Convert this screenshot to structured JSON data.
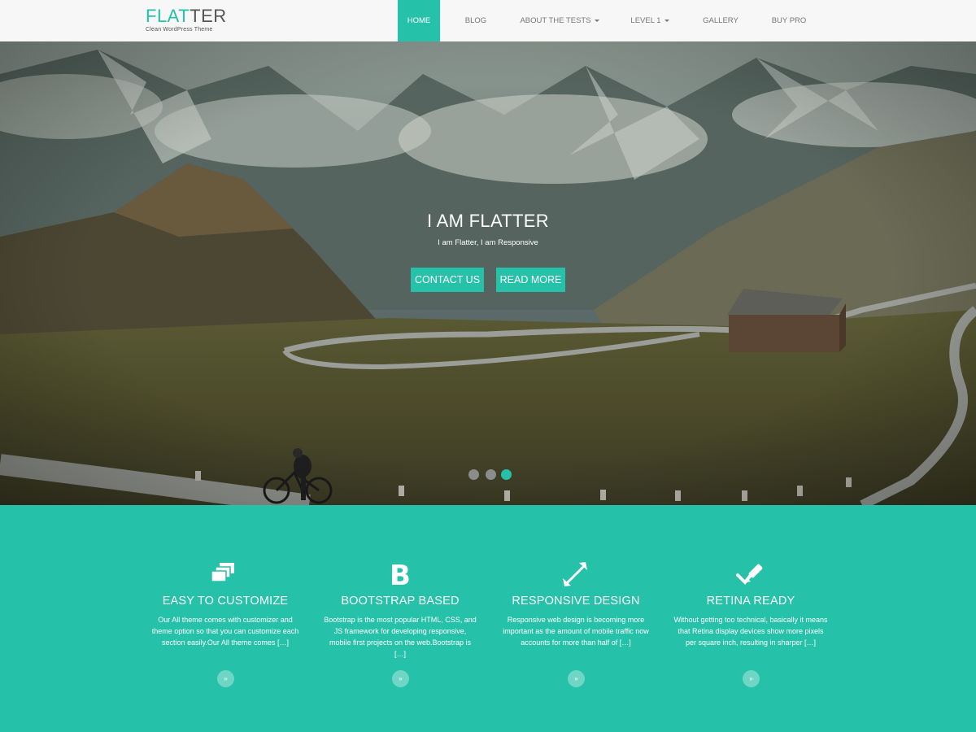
{
  "brand": {
    "name_part1": "FLAT",
    "name_part2": "TER",
    "tagline": "Clean WordPress Theme"
  },
  "nav": {
    "items": [
      {
        "label": "HOME",
        "active": true
      },
      {
        "label": "BLOG"
      },
      {
        "label": "ABOUT THE TESTS",
        "dropdown": true
      },
      {
        "label": "LEVEL 1",
        "dropdown": true
      },
      {
        "label": "GALLERY"
      },
      {
        "label": "BUY PRO"
      }
    ]
  },
  "hero": {
    "title": "I AM FLATTER",
    "subtitle": "I am Flatter, I am Responsive",
    "buttons": {
      "contact": "CONTACT US",
      "read_more": "READ MORE"
    },
    "slides": {
      "count": 3,
      "active_index": 3
    }
  },
  "features": [
    {
      "icon": "layers-icon",
      "title": "EASY TO CUSTOMIZE",
      "description": "Our All theme comes with customizer and theme option so that you can customize each section easily.Our All theme comes […]",
      "more": "»"
    },
    {
      "icon": "bootstrap-icon",
      "title": "BOOTSTRAP BASED",
      "description": "Bootstrap is the most popular HTML, CSS, and JS framework for developing responsive, mobile first projects on the web.Bootstrap is […]",
      "more": "»"
    },
    {
      "icon": "expand-icon",
      "title": "RESPONSIVE DESIGN",
      "description": "Responsive web design is becoming more important as the amount of mobile traffic now accounts for more than half of […]",
      "more": "»"
    },
    {
      "icon": "check-pencil-icon",
      "title": "RETINA READY",
      "description": "Without getting too technical, basically it means that Retina display devices show more pixels per square inch, resulting in sharper […]",
      "more": "»"
    }
  ],
  "colors": {
    "accent": "#26c1a9",
    "nav_bg": "#f7f7f7",
    "nav_text": "#777777",
    "brand_dark": "#555555"
  }
}
